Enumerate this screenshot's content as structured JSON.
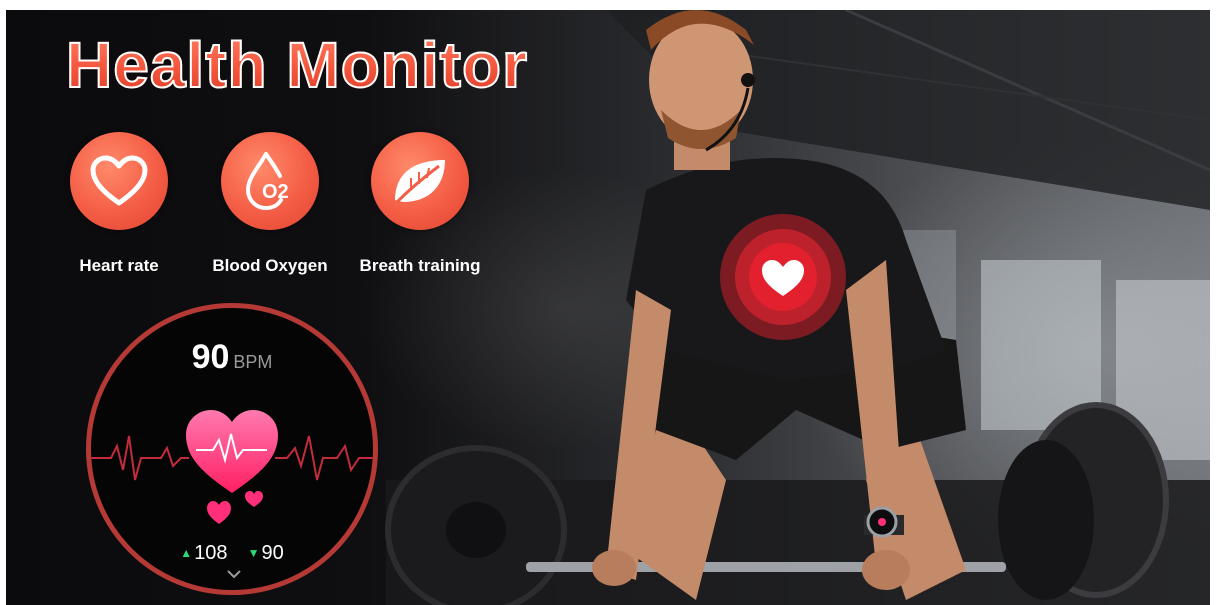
{
  "banner": {
    "title": "Health Monitor",
    "features": [
      {
        "label": "Heart rate",
        "icon": "heart-outline-icon"
      },
      {
        "label": "Blood Oxygen",
        "icon": "blood-drop-o2-icon",
        "icon_text": "O2"
      },
      {
        "label": "Breath training",
        "icon": "leaf-icon"
      }
    ],
    "watch": {
      "bpm_value": "90",
      "bpm_unit": "BPM",
      "max_value": "108",
      "min_value": "90",
      "up_arrow": "▲",
      "down_arrow": "▼"
    },
    "colors": {
      "accent": "#f4563c",
      "ring": "#b53a36",
      "heart_pink": "#ff2f7a",
      "up_green": "#2fd87a"
    }
  }
}
